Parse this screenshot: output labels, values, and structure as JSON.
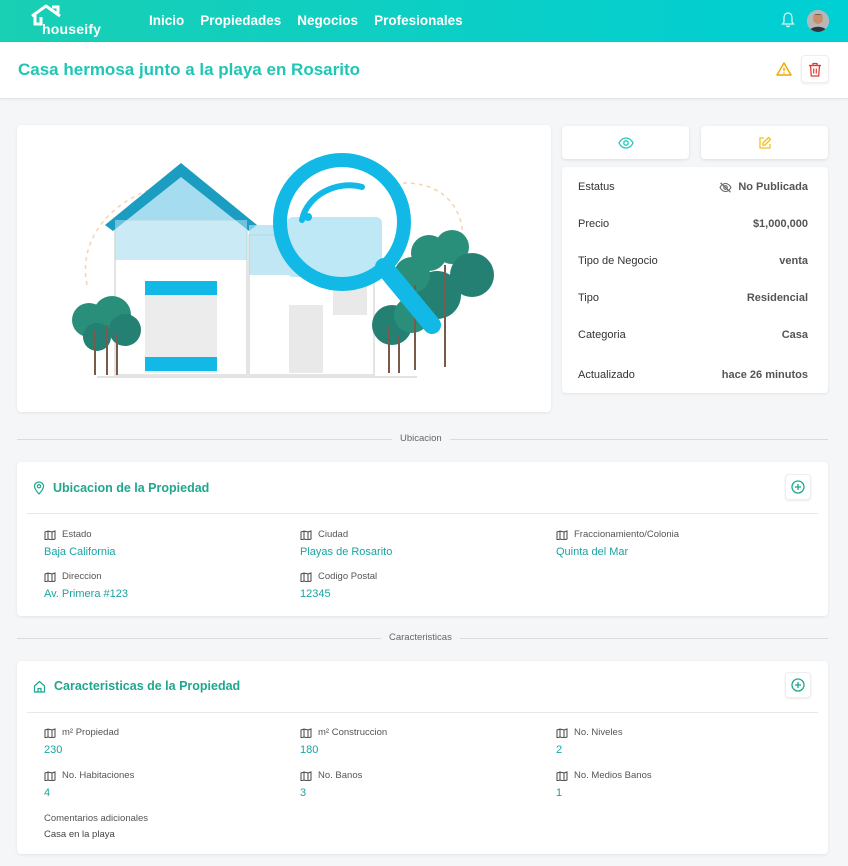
{
  "app": {
    "brand": "houseify"
  },
  "nav": {
    "items": [
      "Inicio",
      "Propiedades",
      "Negocios",
      "Profesionales"
    ]
  },
  "title": "Casa hermosa junto a la playa en Rosarito",
  "details": [
    {
      "label": "Estatus",
      "value": "No Publicada"
    },
    {
      "label": "Precio",
      "value": "$1,000,000"
    },
    {
      "label": "Tipo de Negocio",
      "value": "venta"
    },
    {
      "label": "Tipo",
      "value": "Residencial"
    },
    {
      "label": "Categoria",
      "value": "Casa"
    },
    {
      "label": "Actualizado",
      "value": "hace 26 minutos"
    }
  ],
  "ubicacion": {
    "divider": "Ubicacion",
    "title": "Ubicacion de la Propiedad",
    "fields": [
      {
        "label": "Estado",
        "value": "Baja California"
      },
      {
        "label": "Ciudad",
        "value": "Playas de Rosarito"
      },
      {
        "label": "Fraccionamiento/Colonia",
        "value": "Quinta del Mar"
      },
      {
        "label": "Direccion",
        "value": "Av. Primera #123"
      },
      {
        "label": "Codigo Postal",
        "value": "12345"
      }
    ]
  },
  "caracteristicas": {
    "divider": "Caracteristicas",
    "title": "Caracteristicas de la Propiedad",
    "fields": [
      {
        "label": "m² Propiedad",
        "value": "230"
      },
      {
        "label": "m² Construccion",
        "value": "180"
      },
      {
        "label": "No. Niveles",
        "value": "2"
      },
      {
        "label": "No. Habitaciones",
        "value": "4"
      },
      {
        "label": "No. Banos",
        "value": "3"
      },
      {
        "label": "No. Medios Banos",
        "value": "1"
      }
    ],
    "comments_label": "Comentarios adicionales",
    "comments_value": "Casa en la playa"
  },
  "colors": {
    "brand": "#1fc6b4",
    "accent_value": "#1aa3a3",
    "warning": "#f0a500",
    "danger": "#e53935"
  },
  "icons": {
    "status": "eye-off-icon",
    "view": "eye-icon",
    "edit": "edit-icon",
    "warn": "warning-icon",
    "delete": "trash-icon",
    "location": "map-pin-icon",
    "home": "home-icon",
    "field": "map-icon",
    "add": "plus-circle-icon"
  }
}
